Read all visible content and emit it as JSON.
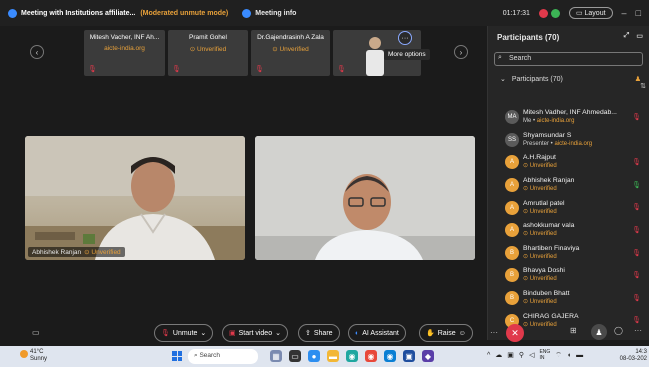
{
  "titlebar": {
    "title": "Meeting with Institutions affiliate...",
    "mode": "(Moderated unmute mode)",
    "info_label": "Meeting info",
    "time": "01:17:31",
    "layout_label": "Layout",
    "minimize": "–",
    "maximize": "□"
  },
  "strip": {
    "prev": "‹",
    "next": "›",
    "tiles": [
      {
        "name": "Mitesh Vacher, INF Ah...",
        "sub": "aicte-india.org"
      },
      {
        "name": "Pramit Gohel",
        "sub": "⊙ Unverified"
      },
      {
        "name": "Dr.Gajendrasinh A Zala",
        "sub": "⊙ Unverified"
      }
    ],
    "more_options_icon": "···",
    "more_options_tooltip": "More options"
  },
  "videos": {
    "left_name": "Abhishek Ranjan",
    "left_status": "⊙ Unverified"
  },
  "panel": {
    "title": "Participants (70)",
    "search_placeholder": "Search",
    "group_label": "Participants (70)",
    "participants": [
      {
        "initials": "MA",
        "name": "Mitesh Vadher, INF Ahmedab...",
        "role": "Me",
        "status": "aicte-india.org",
        "avatar": "grey",
        "mic": "muted"
      },
      {
        "initials": "SS",
        "name": "Shyamsundar S",
        "role": "Presenter",
        "status": "aicte-india.org",
        "avatar": "grey",
        "mic": "none"
      },
      {
        "initials": "A",
        "name": "A.H.Rajput",
        "role": "",
        "status": "⊙ Unverified",
        "avatar": "orange",
        "mic": "muted"
      },
      {
        "initials": "A",
        "name": "Abhishek Ranjan",
        "role": "",
        "status": "⊙ Unverified",
        "avatar": "orange",
        "mic": "active"
      },
      {
        "initials": "A",
        "name": "Amrutlal patel",
        "role": "",
        "status": "⊙ Unverified",
        "avatar": "orange",
        "mic": "muted"
      },
      {
        "initials": "A",
        "name": "ashokkumar vala",
        "role": "",
        "status": "⊙ Unverified",
        "avatar": "orange",
        "mic": "muted"
      },
      {
        "initials": "B",
        "name": "Bhartiben Finaviya",
        "role": "",
        "status": "⊙ Unverified",
        "avatar": "orange",
        "mic": "muted"
      },
      {
        "initials": "B",
        "name": "Bhavya Doshi",
        "role": "",
        "status": "⊙ Unverified",
        "avatar": "orange",
        "mic": "muted"
      },
      {
        "initials": "B",
        "name": "Binduben Bhatt",
        "role": "",
        "status": "⊙ Unverified",
        "avatar": "orange",
        "mic": "muted"
      },
      {
        "initials": "C",
        "name": "CHIRAG GAJERA",
        "role": "",
        "status": "⊙ Unverified",
        "avatar": "orange",
        "mic": "muted"
      }
    ]
  },
  "controls": {
    "unmute": "Unmute",
    "start_video": "Start video",
    "share": "Share",
    "ai_assistant": "AI Assistant",
    "raise": "Raise"
  },
  "taskbar": {
    "temp": "41°C",
    "weather": "Sunny",
    "search_placeholder": "Search",
    "lang_1": "ENG",
    "lang_2": "IN",
    "time": "14:3",
    "date": "08-03-202"
  },
  "colors": {
    "accent_orange": "#e8a13a",
    "end_red": "#e0394b",
    "brand_blue": "#3a8bff"
  }
}
